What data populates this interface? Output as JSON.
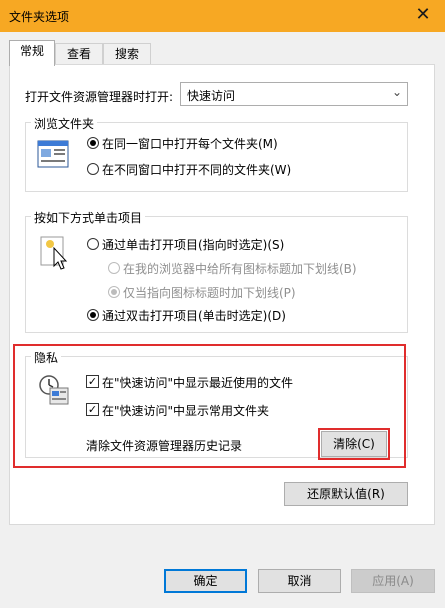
{
  "window": {
    "title": "文件夹选项",
    "close_glyph": "✕"
  },
  "tabs": [
    {
      "label": "常规",
      "active": true
    },
    {
      "label": "查看",
      "active": false
    },
    {
      "label": "搜索",
      "active": false
    }
  ],
  "open_explorer": {
    "label": "打开文件资源管理器时打开:",
    "value": "快速访问"
  },
  "browse": {
    "legend": "浏览文件夹",
    "options": [
      {
        "label": "在同一窗口中打开每个文件夹(M)",
        "selected": true
      },
      {
        "label": "在不同窗口中打开不同的文件夹(W)",
        "selected": false
      }
    ]
  },
  "click": {
    "legend": "按如下方式单击项目",
    "single": {
      "label": "通过单击打开项目(指向时选定)(S)",
      "selected": false
    },
    "sub_options": [
      {
        "label": "在我的浏览器中给所有图标标题加下划线(B)",
        "selected": false
      },
      {
        "label": "仅当指向图标标题时加下划线(P)",
        "selected": true
      }
    ],
    "double": {
      "label": "通过双击打开项目(单击时选定)(D)",
      "selected": true
    }
  },
  "privacy": {
    "legend": "隐私",
    "checks": [
      {
        "label": "在\"快速访问\"中显示最近使用的文件",
        "checked": true
      },
      {
        "label": "在\"快速访问\"中显示常用文件夹",
        "checked": true
      }
    ],
    "clear_history_label": "清除文件资源管理器历史记录",
    "clear_button": "清除(C)"
  },
  "restore_button": "还原默认值(R)",
  "footer": {
    "ok": "确定",
    "cancel": "取消",
    "apply": "应用(A)"
  },
  "colors": {
    "titlebar": "#f7a823",
    "highlight": "#e02d2d",
    "focus": "#0078d7"
  }
}
